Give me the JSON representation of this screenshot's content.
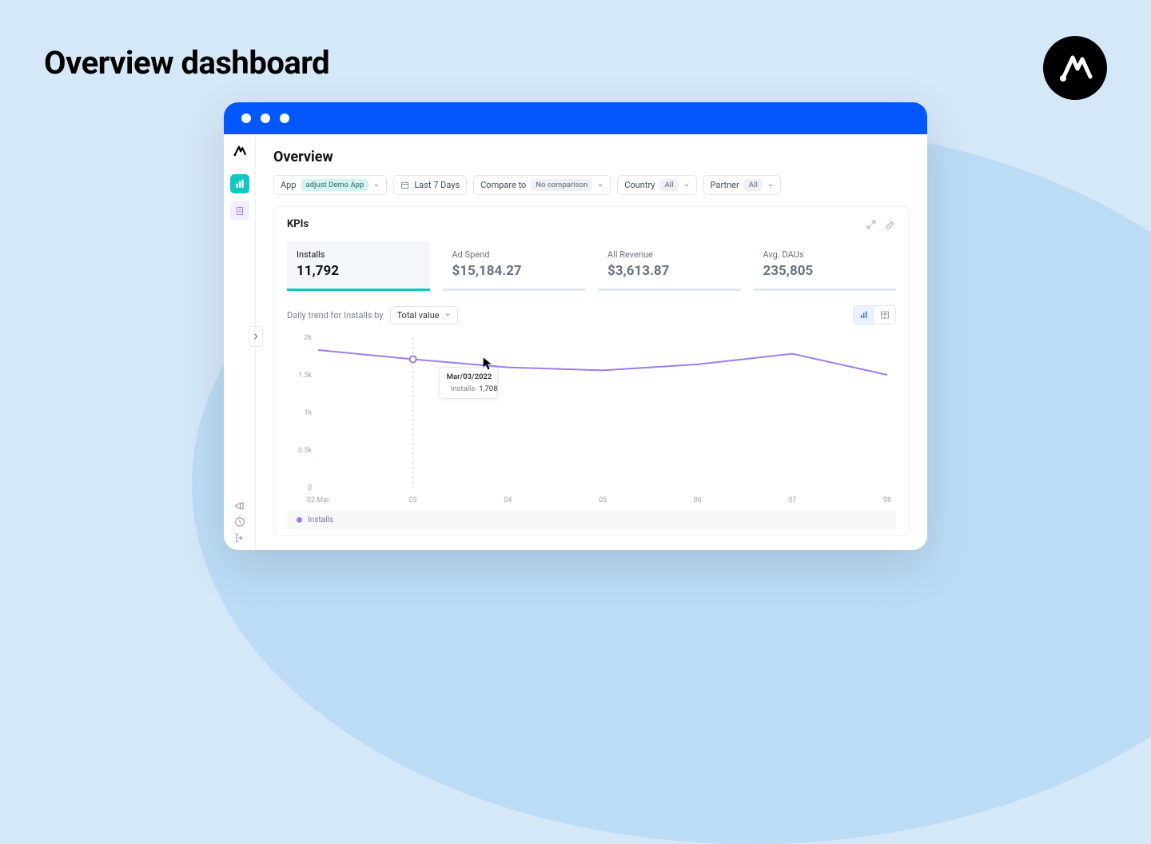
{
  "page_title": "Overview dashboard",
  "window": {
    "overview_title": "Overview",
    "filters": {
      "app": {
        "label": "App",
        "value": "adjust Demo App"
      },
      "date_range": "Last 7 Days",
      "compare": {
        "label": "Compare to",
        "value": "No comparison"
      },
      "country": {
        "label": "Country",
        "value": "All"
      },
      "partner": {
        "label": "Partner",
        "value": "All"
      }
    },
    "panel": {
      "title": "KPIs",
      "kpis": [
        {
          "label": "Installs",
          "value": "11,792",
          "active": true
        },
        {
          "label": "Ad Spend",
          "value": "$15,184.27"
        },
        {
          "label": "All Revenue",
          "value": "$3,613.87"
        },
        {
          "label": "Avg. DAUs",
          "value": "235,805"
        }
      ],
      "trend_label": "Daily trend for Installs by",
      "trend_select_value": "Total value",
      "legend_series": "Installs",
      "tooltip": {
        "date": "Mar/03/2022",
        "series": "Installs",
        "value": "1,708"
      }
    }
  },
  "chart_data": {
    "type": "line",
    "title": "Daily trend for Installs",
    "xlabel": "",
    "ylabel": "",
    "ylim": [
      0,
      2000
    ],
    "y_ticks": [
      "0",
      "0.5k",
      "1k",
      "1.5k",
      "2k"
    ],
    "categories": [
      "02 Mar",
      "03",
      "04",
      "05",
      "06",
      "07",
      "08"
    ],
    "series": [
      {
        "name": "Installs",
        "color": "#9c7eea",
        "values": [
          1830,
          1708,
          1600,
          1560,
          1640,
          1780,
          1500
        ]
      }
    ],
    "hover_index": 1
  }
}
